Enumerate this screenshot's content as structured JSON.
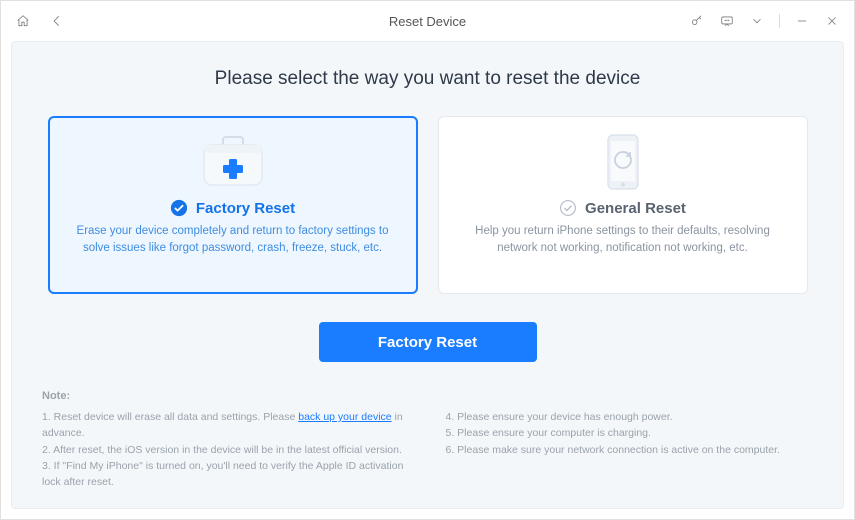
{
  "titlebar": {
    "title": "Reset Device"
  },
  "heading": "Please select the way you want to reset the device",
  "cards": {
    "factory": {
      "title": "Factory Reset",
      "desc": "Erase your device completely and return to factory settings to solve issues like forgot password, crash, freeze, stuck, etc."
    },
    "general": {
      "title": "General Reset",
      "desc": "Help you return iPhone settings to their defaults, resolving network not working, notification not working, etc."
    }
  },
  "cta_label": "Factory Reset",
  "notes": {
    "title": "Note:",
    "line1_pre": "1. Reset device will erase all data and settings. Please ",
    "line1_link": "back up your device",
    "line1_post": " in advance.",
    "line2": "2. After reset, the iOS version in the device will be in the latest official version.",
    "line3": "3. If \"Find My iPhone\" is turned on, you'll need to verify the Apple ID activation lock after reset.",
    "line4": "4. Please ensure your device has enough power.",
    "line5": "5. Please ensure your computer is charging.",
    "line6": "6. Please make sure your network connection is active on the computer."
  }
}
